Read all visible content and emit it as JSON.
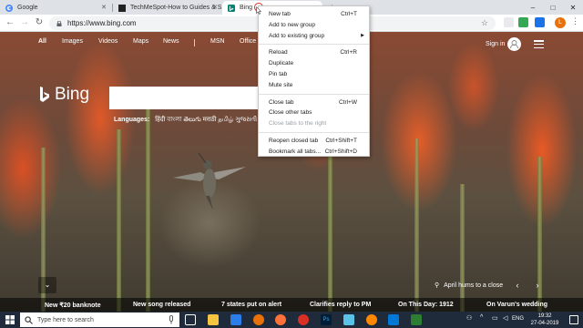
{
  "browser": {
    "tabs": [
      {
        "title": "Google",
        "favicon": "google-icon"
      },
      {
        "title": "TechMeSpot-How to Guides & S",
        "favicon": "techmespot-icon"
      },
      {
        "title": "Bing",
        "favicon": "bing-icon"
      }
    ],
    "url": "https://www.bing.com",
    "window_buttons": [
      "–",
      "□",
      "✕"
    ]
  },
  "context_menu": {
    "items": [
      {
        "label": "New tab",
        "shortcut": "Ctrl+T",
        "disabled": false
      },
      {
        "label": "Add to new group",
        "shortcut": "",
        "disabled": false
      },
      {
        "label": "Add to existing group",
        "shortcut": "",
        "submenu": true,
        "disabled": false
      },
      {
        "separator": true
      },
      {
        "label": "Reload",
        "shortcut": "Ctrl+R",
        "disabled": false
      },
      {
        "label": "Duplicate",
        "shortcut": "",
        "disabled": false
      },
      {
        "label": "Pin tab",
        "shortcut": "",
        "disabled": false
      },
      {
        "label": "Mute site",
        "shortcut": "",
        "disabled": false
      },
      {
        "separator": true
      },
      {
        "label": "Close tab",
        "shortcut": "Ctrl+W",
        "disabled": false
      },
      {
        "label": "Close other tabs",
        "shortcut": "",
        "disabled": false
      },
      {
        "label": "Close tabs to the right",
        "shortcut": "",
        "disabled": true
      },
      {
        "separator": true
      },
      {
        "label": "Reopen closed tab",
        "shortcut": "Ctrl+Shift+T",
        "disabled": false
      },
      {
        "label": "Bookmark all tabs...",
        "shortcut": "Ctrl+Shift+D",
        "disabled": false
      }
    ]
  },
  "bing": {
    "nav": [
      "All",
      "Images",
      "Videos",
      "Maps",
      "News",
      "MSN",
      "Office"
    ],
    "signin": "Sign in",
    "logo_text": "Bing",
    "languages_label": "Languages:",
    "languages": "हिंदी  বাংলা  తెలుగు  मराठी  தமிழ்  ગુજરાતી",
    "image_caption": "April hums to a close",
    "scroll_down": "⌄",
    "news": [
      "New ₹20 banknote",
      "New song released",
      "7 states put on alert",
      "Clarifies reply to PM",
      "On This Day: 1912",
      "On Varun's wedding"
    ]
  },
  "taskbar": {
    "search_placeholder": "Type here to search",
    "time": "19:32",
    "date": "27-04-2019",
    "lang": "ENG"
  },
  "colors": {
    "chrome_tabstrip": "#dee1e6",
    "taskbar": "#1f2b3a",
    "avatar": "#e8710a"
  }
}
